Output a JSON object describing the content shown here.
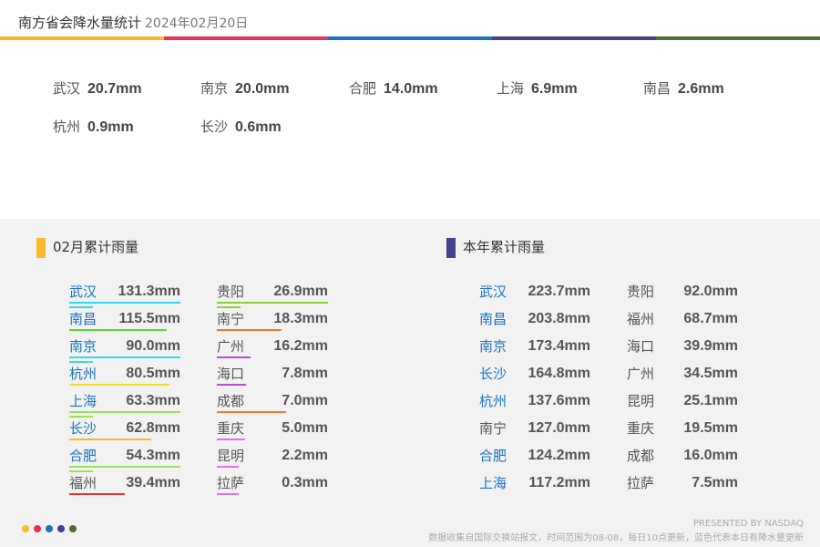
{
  "header": {
    "title": "南方省会降水量统计",
    "date": "2024年02月20日",
    "colors": [
      "#fbb829",
      "#e8305a",
      "#1a73c0",
      "#44418f",
      "#4d6d36"
    ]
  },
  "today": [
    {
      "city": "武汉",
      "value": "20.7mm"
    },
    {
      "city": "南京",
      "value": "20.0mm"
    },
    {
      "city": "合肥",
      "value": "14.0mm"
    },
    {
      "city": "上海",
      "value": "6.9mm"
    },
    {
      "city": "南昌",
      "value": "2.6mm"
    },
    {
      "city": "杭州",
      "value": "0.9mm"
    },
    {
      "city": "长沙",
      "value": "0.6mm"
    }
  ],
  "monthly": {
    "title": "02月累计雨量",
    "marker_color": "#fbb829",
    "items": [
      {
        "city": "武汉",
        "value": "131.3mm",
        "blue": true,
        "underline": "#3ad6f0",
        "fill": 1.0
      },
      {
        "city": "南昌",
        "value": "115.5mm",
        "blue": true,
        "underline": "#5ad630",
        "fill": 0.88
      },
      {
        "city": "南京",
        "value": "90.0mm",
        "blue": true,
        "underline": "#3ad6f0",
        "fill": 1.0
      },
      {
        "city": "杭州",
        "value": "80.5mm",
        "blue": true,
        "underline": "#f0e030",
        "fill": 0.9
      },
      {
        "city": "上海",
        "value": "63.3mm",
        "blue": true,
        "underline": "#9be05a",
        "fill": 1.0
      },
      {
        "city": "长沙",
        "value": "62.8mm",
        "blue": true,
        "underline": "#fbb829",
        "fill": 0.74
      },
      {
        "city": "合肥",
        "value": "54.3mm",
        "blue": true,
        "underline": "#9be05a",
        "fill": 1.0
      },
      {
        "city": "福州",
        "value": "39.4mm",
        "blue": false,
        "underline": "#e83030",
        "fill": 0.5
      },
      {
        "city": "贵阳",
        "value": "26.9mm",
        "blue": false,
        "underline": "#8ad630",
        "fill": 1.0
      },
      {
        "city": "南宁",
        "value": "18.3mm",
        "blue": false,
        "underline": "#f07830",
        "fill": 0.58
      },
      {
        "city": "广州",
        "value": "16.2mm",
        "blue": false,
        "underline": "#b050e0",
        "fill": 0.3
      },
      {
        "city": "海口",
        "value": "7.8mm",
        "blue": false,
        "underline": "#b050e0",
        "fill": 0.26
      },
      {
        "city": "成都",
        "value": "7.0mm",
        "blue": false,
        "underline": "#f07830",
        "fill": 0.62
      },
      {
        "city": "重庆",
        "value": "5.0mm",
        "blue": false,
        "underline": "#e070f0",
        "fill": 0.25
      },
      {
        "city": "昆明",
        "value": "2.2mm",
        "blue": false,
        "underline": "#e070f0",
        "fill": 0.2
      },
      {
        "city": "拉萨",
        "value": "0.3mm",
        "blue": false,
        "underline": "#e070f0",
        "fill": 0.2
      }
    ]
  },
  "yearly": {
    "title": "本年累计雨量",
    "marker_color": "#44418f",
    "items": [
      {
        "city": "武汉",
        "value": "223.7mm",
        "blue": true
      },
      {
        "city": "南昌",
        "value": "203.8mm",
        "blue": true
      },
      {
        "city": "南京",
        "value": "173.4mm",
        "blue": true
      },
      {
        "city": "长沙",
        "value": "164.8mm",
        "blue": true
      },
      {
        "city": "杭州",
        "value": "137.6mm",
        "blue": true
      },
      {
        "city": "南宁",
        "value": "127.0mm",
        "blue": false
      },
      {
        "city": "合肥",
        "value": "124.2mm",
        "blue": true
      },
      {
        "city": "上海",
        "value": "117.2mm",
        "blue": true
      },
      {
        "city": "贵阳",
        "value": "92.0mm",
        "blue": false
      },
      {
        "city": "福州",
        "value": "68.7mm",
        "blue": false
      },
      {
        "city": "海口",
        "value": "39.9mm",
        "blue": false
      },
      {
        "city": "广州",
        "value": "34.5mm",
        "blue": false
      },
      {
        "city": "昆明",
        "value": "25.1mm",
        "blue": false
      },
      {
        "city": "重庆",
        "value": "19.5mm",
        "blue": false
      },
      {
        "city": "成都",
        "value": "16.0mm",
        "blue": false
      },
      {
        "city": "拉萨",
        "value": "7.5mm",
        "blue": false
      }
    ]
  },
  "footer": {
    "credit": "PRESENTED BY NASDAQ",
    "note": "数据收集自国际交换站报文，时间范围为08-08，每日10点更新，蓝色代表本日有降水量更新"
  }
}
